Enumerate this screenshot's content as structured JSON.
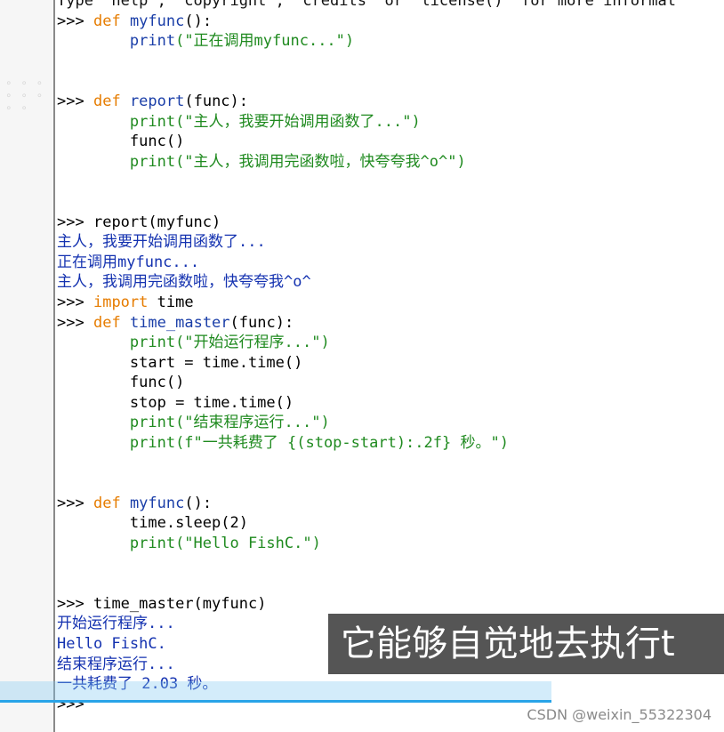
{
  "header_partial": "Type \"help\", \"copyright\", \"credits\" or \"license()\" for more informat",
  "prompt": ">>>",
  "block1": {
    "def": "def",
    "name": "myfunc",
    "sig": "():",
    "print_kw": "print",
    "str": "(\"正在调用myfunc...\")"
  },
  "block2": {
    "def": "def",
    "name": "report",
    "sig": "(func):",
    "l1": "print(\"主人，我要开始调用函数了...\")",
    "l2": "func()",
    "l3": "print(\"主人，我调用完函数啦，快夸夸我^o^\")"
  },
  "block3": {
    "call": "report(myfunc)",
    "out1": "主人，我要开始调用函数了...",
    "out2": "正在调用myfunc...",
    "out3": "主人，我调用完函数啦，快夸夸我^o^"
  },
  "block4": {
    "import_kw": "import",
    "module": " time"
  },
  "block5": {
    "def": "def",
    "name": "time_master",
    "sig": "(func):",
    "l1": "print(\"开始运行程序...\")",
    "l2": "start = time.time()",
    "l3": "func()",
    "l4": "stop = time.time()",
    "l5": "print(\"结束程序运行...\")",
    "l6": "print(f\"一共耗费了 {(stop-start):.2f} 秒。\")"
  },
  "block6": {
    "def": "def",
    "name": "myfunc",
    "sig": "():",
    "l1": "time.sleep(2)",
    "l2": "print(\"Hello FishC.\")"
  },
  "block7": {
    "call": "time_master(myfunc)",
    "out1": "开始运行程序...",
    "out2": "Hello FishC.",
    "out3": "结束程序运行...",
    "out4": "一共耗费了 2.03 秒。"
  },
  "subtitle": "它能够自觉地去执行t",
  "watermark": "CSDN @weixin_55322304"
}
